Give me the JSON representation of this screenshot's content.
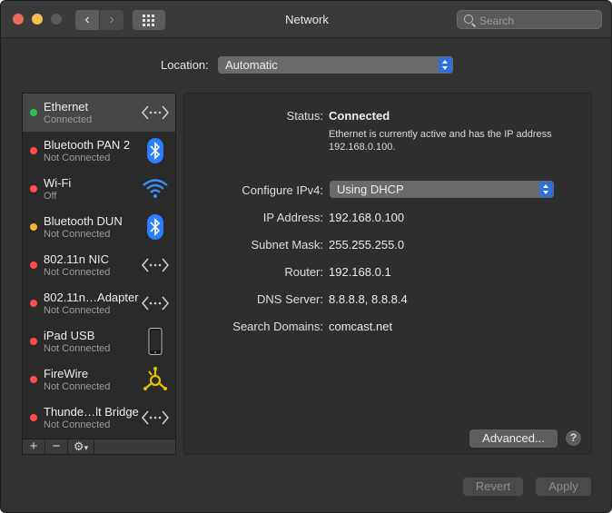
{
  "window": {
    "title": "Network"
  },
  "toolbar": {
    "search_placeholder": "Search",
    "back_glyph": "‹",
    "forward_glyph": "›"
  },
  "location": {
    "label": "Location:",
    "value": "Automatic"
  },
  "services": [
    {
      "name": "Ethernet",
      "status": "Connected",
      "dot": "#2fc150",
      "icon": "ethernet-arrows-icon",
      "selected": true
    },
    {
      "name": "Bluetooth PAN 2",
      "status": "Not Connected",
      "dot": "#ff4d4d",
      "icon": "bluetooth-icon"
    },
    {
      "name": "Wi-Fi",
      "status": "Off",
      "dot": "#ff4d4d",
      "icon": "wifi-icon"
    },
    {
      "name": "Bluetooth DUN",
      "status": "Not Connected",
      "dot": "#f5b72d",
      "icon": "bluetooth-icon"
    },
    {
      "name": "802.11n NIC",
      "status": "Not Connected",
      "dot": "#ff4d4d",
      "icon": "ethernet-arrows-icon"
    },
    {
      "name": "802.11n…Adapter",
      "status": "Not Connected",
      "dot": "#ff4d4d",
      "icon": "ethernet-arrows-icon"
    },
    {
      "name": "iPad USB",
      "status": "Not Connected",
      "dot": "#ff4d4d",
      "icon": "ipad-icon"
    },
    {
      "name": "FireWire",
      "status": "Not Connected",
      "dot": "#ff4d4d",
      "icon": "firewire-icon"
    },
    {
      "name": "Thunde…lt Bridge",
      "status": "Not Connected",
      "dot": "#ff4d4d",
      "icon": "ethernet-arrows-icon"
    }
  ],
  "sidebar_buttons": {
    "add": "+",
    "remove": "−",
    "action": "⚙"
  },
  "details": {
    "status_label": "Status:",
    "status_value": "Connected",
    "status_description": "Ethernet is currently active and has the IP address 192.168.0.100.",
    "configure_label": "Configure IPv4:",
    "configure_value": "Using DHCP",
    "ip_label": "IP Address:",
    "ip_value": "192.168.0.100",
    "subnet_label": "Subnet Mask:",
    "subnet_value": "255.255.255.0",
    "router_label": "Router:",
    "router_value": "192.168.0.1",
    "dns_label": "DNS Server:",
    "dns_value": "8.8.8.8, 8.8.8.4",
    "search_domains_label": "Search Domains:",
    "search_domains_value": "comcast.net"
  },
  "buttons": {
    "advanced": "Advanced...",
    "help": "?",
    "revert": "Revert",
    "apply": "Apply"
  },
  "colors": {
    "accent": "#2d6fdc",
    "bluetooth": "#2d7ff9",
    "wifi": "#3b8ff5",
    "firewire": "#e6c200"
  }
}
